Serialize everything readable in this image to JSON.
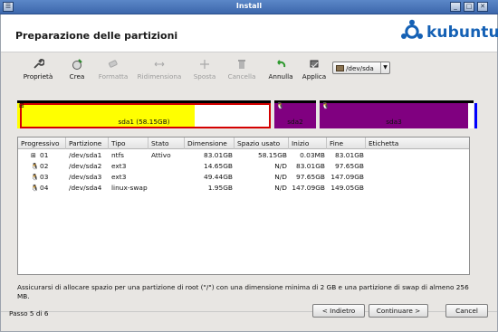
{
  "window": {
    "title": "Install"
  },
  "header": {
    "title": "Preparazione delle partizioni",
    "brand": "kubuntu"
  },
  "toolbar": {
    "items": [
      {
        "label": "Proprietà",
        "icon": "wrench-icon",
        "enabled": true
      },
      {
        "label": "Crea",
        "icon": "create-partition-icon",
        "enabled": true
      },
      {
        "label": "Formatta",
        "icon": "eraser-icon",
        "enabled": false
      },
      {
        "label": "Ridimensiona",
        "icon": "resize-icon",
        "enabled": false
      },
      {
        "label": "Sposta",
        "icon": "move-icon",
        "enabled": false
      },
      {
        "label": "Cancella",
        "icon": "trash-icon",
        "enabled": false
      },
      {
        "label": "Annulla",
        "icon": "undo-icon",
        "enabled": true
      },
      {
        "label": "Applica",
        "icon": "apply-icon",
        "enabled": true
      }
    ],
    "device": "/dev/sda"
  },
  "partition_map": [
    {
      "label": "sda1 (58.15GB)",
      "color": "#ffff00",
      "cap": "#000000",
      "used_fraction": 0.7,
      "selected": true
    },
    {
      "label": "sda2",
      "color": "#800080",
      "cap": "#000000"
    },
    {
      "label": "sda3",
      "color": "#800080",
      "cap": "#000000"
    },
    {
      "label": "",
      "color": "#ffffff",
      "cap": "#000000"
    },
    {
      "label": "",
      "color": "#0000ff",
      "cap": "#0000ff"
    }
  ],
  "table": {
    "columns": [
      "Progressivo",
      "Partizione",
      "Tipo",
      "Stato",
      "Dimensione",
      "Spazio usato",
      "Inizio",
      "Fine",
      "Etichetta"
    ],
    "rows": [
      {
        "num": "01",
        "partition": "/dev/sda1",
        "type": "ntfs",
        "state": "Attivo",
        "size": "83.01GB",
        "used": "58.15GB",
        "start": "0.03MB",
        "end": "83.01GB",
        "label": "",
        "icon": "windows-icon"
      },
      {
        "num": "02",
        "partition": "/dev/sda2",
        "type": "ext3",
        "state": "",
        "size": "14.65GB",
        "used": "N/D",
        "start": "83.01GB",
        "end": "97.65GB",
        "label": "",
        "icon": "penguin-icon"
      },
      {
        "num": "03",
        "partition": "/dev/sda3",
        "type": "ext3",
        "state": "",
        "size": "49.44GB",
        "used": "N/D",
        "start": "97.65GB",
        "end": "147.09GB",
        "label": "",
        "icon": "penguin-icon"
      },
      {
        "num": "04",
        "partition": "/dev/sda4",
        "type": "linux-swap",
        "state": "",
        "size": "1.95GB",
        "used": "N/D",
        "start": "147.09GB",
        "end": "149.05GB",
        "label": "",
        "icon": "penguin-icon"
      }
    ]
  },
  "note": "Assicurarsi di allocare spazio per una partizione di root (\"/\") con una dimensione minima di 2 GB e una partizione di swap di almeno 256 MB.",
  "footer": {
    "step": "Passo 5 di 6",
    "back": "< Indietro",
    "next": "Continuare >",
    "cancel": "Cancel"
  },
  "colors": {
    "titlebar": "#4a76bb",
    "brand": "#1561b5"
  }
}
